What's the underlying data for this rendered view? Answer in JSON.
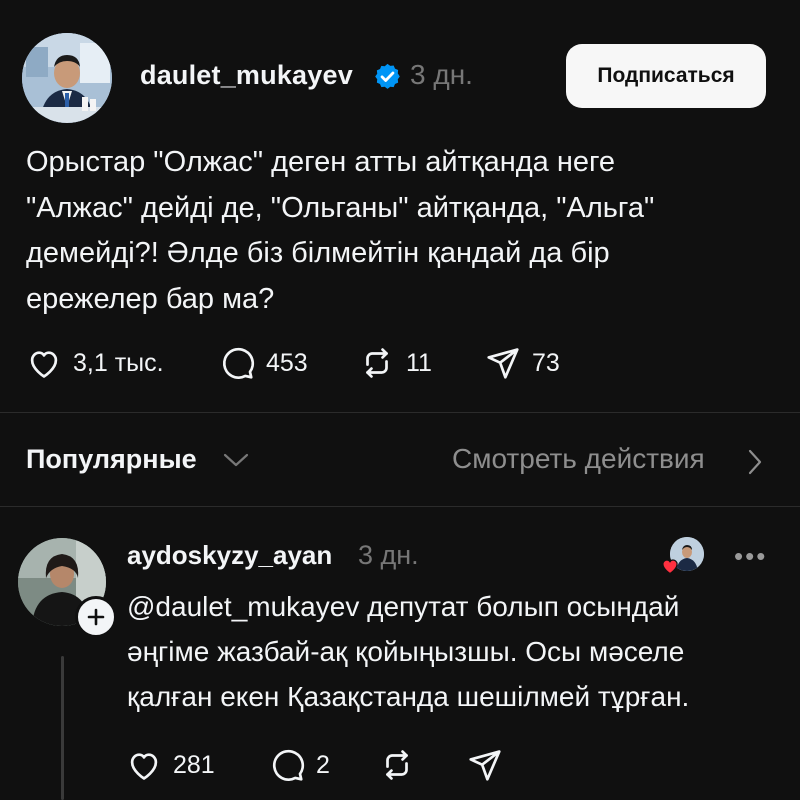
{
  "post": {
    "username": "daulet_mukayev",
    "time": "3 дн.",
    "follow_label": "Подписаться",
    "text": "Орыстар \"Олжас\" деген атты айтқанда неге\n\"Алжас\" дейді де, \"Ольганы\" айтқанда, \"Альга\"\nдемейді?! Әлде біз білмейтін қандай да бір\nережелер бар ма?",
    "likes": "3,1 тыс.",
    "comments": "453",
    "reposts": "11",
    "shares": "73"
  },
  "replies_header": {
    "sort_label": "Популярные",
    "activity_label": "Смотреть действия"
  },
  "reply": {
    "username": "aydoskyzy_ayan",
    "time": "3 дн.",
    "more": "•••",
    "text": "@daulet_mukayev депутат болып осындай\nәңгіме жазбай-ақ қойыңызшы. Осы мәселе\nқалған екен Қазақстанда шешілмей тұрған.",
    "likes": "281",
    "comments": "2"
  },
  "colors": {
    "background": "#101010",
    "text": "#f3f5f7",
    "muted": "#777777",
    "verified": "#0095f6",
    "heart": "#ff3040"
  }
}
